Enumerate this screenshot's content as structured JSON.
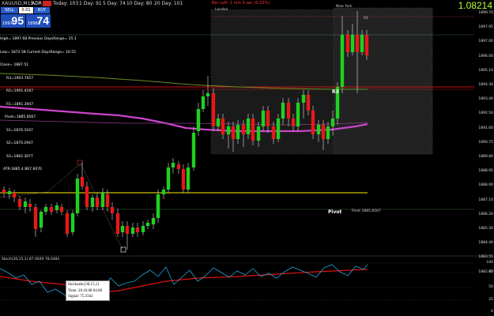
{
  "topbar": {
    "symbol": "XAUUSD,M15",
    "indicator": "ADR",
    "badge": "",
    "today": "Today: 103",
    "day1": "1 Day: 91",
    "day5": "5 Day: 74",
    "day10": "10 Day: 80",
    "day20": "20 Day: 101",
    "alert": "Bar Left: 1 min 0 sec (0.10%)"
  },
  "trade": {
    "sell_label": "SELL",
    "buy_label": "BUY",
    "lot": "0.01",
    "sell_prefix": "1897",
    "sell_big": "95",
    "buy_prefix": "1898",
    "buy_big": "74"
  },
  "info_lines": [
    "High= 1897.68 Previous DaysRange= 25.1",
    "Low= 1872.58 Current DaysRange= 16.55",
    "Close= 1887.51",
    "R3=1903.7657",
    "R2=1901.4167",
    "R1=1891.3947",
    "Pivot=1885.8567",
    "S1=1876.3167",
    "S2=1870.2947",
    "S3=1862.3077",
    "ATR-1885.4 B67.6070"
  ],
  "price_label": "1.08214",
  "axis_labels": [
    "1899.70",
    "1897.95",
    "1897.00",
    "1896.00",
    "1895.10",
    "1894.30",
    "1893.40",
    "1892.50",
    "1891.60",
    "1890.75",
    "1889.80",
    "1888.95",
    "1888.00",
    "1887.10",
    "1886.20",
    "1885.30",
    "1884.40",
    "1883.55",
    "1882.60"
  ],
  "chart_labels": {
    "london": "London",
    "newyork": "New York",
    "r1_top": "R1",
    "r3": "R3",
    "pivot": "Pivot",
    "pivot_value": "Pivot 1885.8567"
  },
  "stoch": {
    "title": "Stoch(30,15,1) 87.0049 78.0481",
    "levels": [
      "100",
      "75",
      "50",
      "25",
      "0"
    ]
  },
  "tooltip": {
    "line1": "Stochastic(30,15,1)",
    "line2": "Time: 20.10.08 04:00",
    "line3": "Signal: 75.3342"
  },
  "colors": {
    "bull": "#1fd11f",
    "bear": "#e81818",
    "ma_magenta": "#cc44cc",
    "ma_olive": "#6b8e23",
    "r_red": "#cc1111",
    "pivot_yellow": "#ffee00",
    "accent": "#1f4fbf",
    "price_green": "#b6ff3a"
  }
}
